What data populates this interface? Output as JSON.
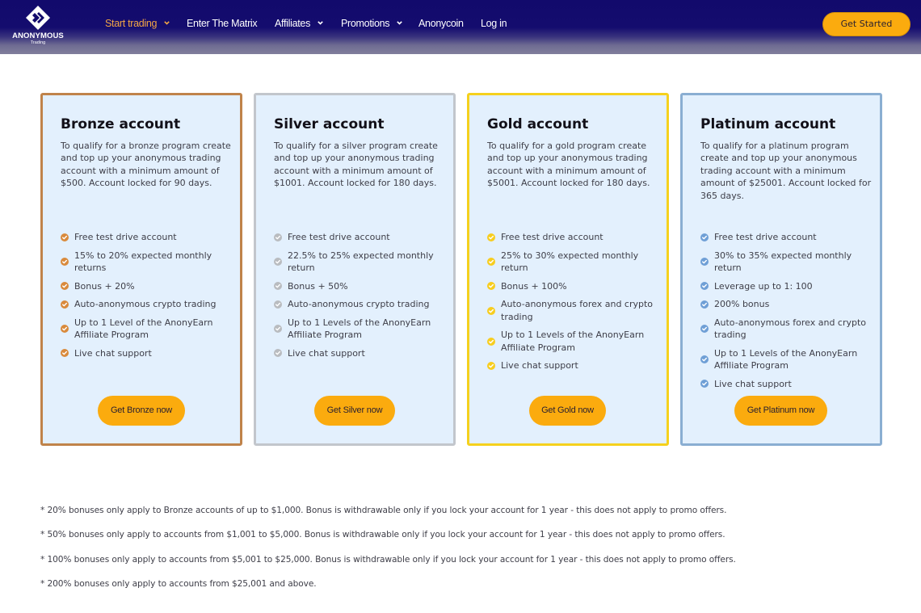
{
  "header": {
    "logo": {
      "name": "ANONYMOUS",
      "subtitle": "Trading",
      "icon": "diamond-logo-icon"
    },
    "nav": [
      {
        "label": "Start trading",
        "has_dropdown": true,
        "active": true
      },
      {
        "label": "Enter The Matrix",
        "has_dropdown": false,
        "active": false
      },
      {
        "label": "Affiliates",
        "has_dropdown": true,
        "active": false
      },
      {
        "label": "Promotions",
        "has_dropdown": true,
        "active": false
      },
      {
        "label": "Anonycoin",
        "has_dropdown": false,
        "active": false
      },
      {
        "label": "Log in",
        "has_dropdown": false,
        "active": false
      }
    ],
    "cta_label": "Get Started"
  },
  "colors": {
    "header_bg": "#120a6c",
    "accent": "#fbab0e",
    "active_nav": "#f2a545",
    "card_bg": "#e3f0fd",
    "bronze": "#c0834a",
    "silver": "#c2c6cc",
    "gold": "#f5d11d",
    "platinum": "#8aaed2"
  },
  "cards": [
    {
      "tier": "Bronze",
      "suffix": "account",
      "description": "To qualify for a bronze program create and top up your anonymous trading account with a minimum amount of $500. Account locked for 90 days.",
      "check_color": "#d98a3c",
      "features": [
        "Free test drive account",
        "15% to 20% expected monthly returns",
        "Bonus + 20%",
        "Auto-anonymous crypto trading",
        "Up to 1 Level of the AnonyEarn Affiliate Program",
        "Live chat support"
      ],
      "button_label": "Get Bronze now"
    },
    {
      "tier": "Silver",
      "suffix": "account",
      "description": "To qualify for a silver program create and top up your anonymous trading account with a minimum amount of $1001. Account locked for 180 days.",
      "check_color": "#b9bcc0",
      "features": [
        "Free test drive account",
        "22.5% to 25% expected monthly return",
        "Bonus + 50%",
        "Auto-anonymous crypto trading",
        "Up to 1 Levels of the AnonyEarn Affiliate Program",
        "Live chat support"
      ],
      "button_label": "Get Silver now"
    },
    {
      "tier": "Gold",
      "suffix": "account",
      "description": "To qualify for a gold program create and top up your anonymous trading account with a minimum amount of $5001. Account locked for 180 days.",
      "check_color": "#f7cd1f",
      "features": [
        "Free test drive account",
        "25% to 30% expected monthly return",
        "Bonus + 100%",
        "Auto-anonymous forex and crypto trading",
        "Up to 1 Levels of the AnonyEarn Affiliate Program",
        "Live chat support"
      ],
      "button_label": "Get Gold now"
    },
    {
      "tier": "Platinum",
      "suffix": "account",
      "description": "To qualify for a platinum program create and top up your anonymous trading account with a minimum amount of $25001. Account locked for 365 days.",
      "check_color": "#6f9fd6",
      "features": [
        "Free test drive account",
        "30% to 35% expected monthly return",
        "Leverage up to 1: 100",
        "200% bonus",
        "Auto-anonymous forex and crypto trading",
        "Up to 1 Levels of the AnonyEarn Affiliate Program",
        "Live chat support"
      ],
      "button_label": "Get Platinum now"
    }
  ],
  "notes": [
    "* 20% bonuses only apply to Bronze accounts of up to $1,000. Bonus is withdrawable only if you lock your account for 1 year - this does not apply to promo offers.",
    "* 50% bonuses only apply to accounts from $1,001 to $5,000. Bonus is withdrawable only if you lock your account for 1 year - this does not apply to promo offers.",
    "* 100% bonuses only apply to accounts from $5,001 to $25,000. Bonus is withdrawable only if you lock your account for 1 year - this does not apply to promo offers.",
    "* 200% bonuses only apply to accounts from $25,001 and above."
  ]
}
